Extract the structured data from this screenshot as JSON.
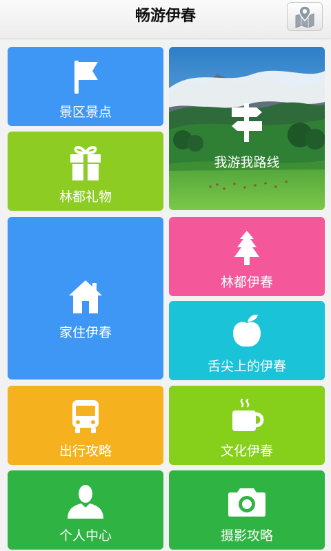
{
  "header": {
    "title": "畅游伊春",
    "map_icon": "map-pin-icon"
  },
  "tiles": {
    "scenic": {
      "label": "景区景点",
      "icon": "flag-icon",
      "color": "#3f97f5"
    },
    "route": {
      "label": "我游我路线",
      "icon": "signpost-icon"
    },
    "gifts": {
      "label": "林都礼物",
      "icon": "gift-icon",
      "color": "#8ccc23"
    },
    "home": {
      "label": "家住伊春",
      "icon": "house-icon",
      "color": "#3f97f5"
    },
    "forest": {
      "label": "林都伊春",
      "icon": "tree-icon",
      "color": "#f4579a"
    },
    "food": {
      "label": "舌尖上的伊春",
      "icon": "apple-icon",
      "color": "#1ac3d8"
    },
    "travel": {
      "label": "出行攻略",
      "icon": "bus-icon",
      "color": "#f6b21e"
    },
    "culture": {
      "label": "文化伊春",
      "icon": "coffee-cup-icon",
      "color": "#86cf1b"
    },
    "profile": {
      "label": "个人中心",
      "icon": "user-icon",
      "color": "#2fb444"
    },
    "photo": {
      "label": "摄影攻略",
      "icon": "camera-icon",
      "color": "#2fb444"
    }
  }
}
